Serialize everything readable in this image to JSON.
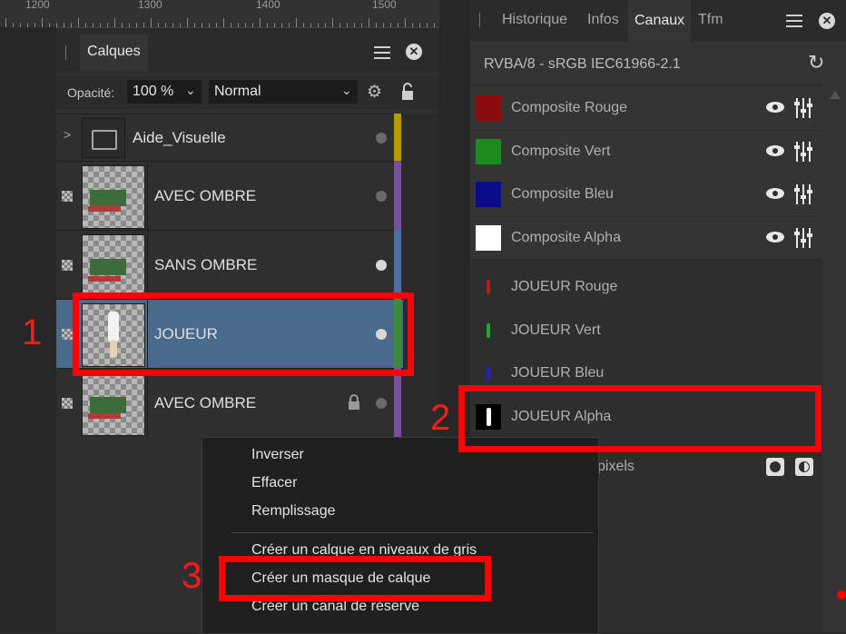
{
  "ruler": {
    "marks": [
      "1200",
      "1300",
      "1400",
      "1500"
    ]
  },
  "layers_panel": {
    "tab": "Calques",
    "opacity_label": "Opacité:",
    "opacity_value": "100 %",
    "blend_mode": "Normal",
    "layers": [
      {
        "name": "Aide_Visuelle",
        "type": "group",
        "color": "#b8960c"
      },
      {
        "name": "AVEC OMBRE",
        "type": "pixel",
        "color": "#7a4fa0"
      },
      {
        "name": "SANS OMBRE",
        "type": "pixel",
        "color": "#4a6fa0"
      },
      {
        "name": "JOUEUR",
        "type": "pixel",
        "selected": true,
        "color": "#3a8c3a"
      },
      {
        "name": "AVEC OMBRE",
        "type": "pixel",
        "locked": true,
        "color": "#7a4fa0"
      }
    ]
  },
  "channels_panel": {
    "tabs": [
      "Historique",
      "Infos",
      "Canaux",
      "Tfm"
    ],
    "active_tab": "Canaux",
    "color_profile": "RVBA/8 - sRGB IEC61966-2.1",
    "composite": [
      {
        "label": "Composite Rouge",
        "color": "#8a0c0c"
      },
      {
        "label": "Composite Vert",
        "color": "#1c8a1c"
      },
      {
        "label": "Composite Bleu",
        "color": "#0c0c8a"
      },
      {
        "label": "Composite Alpha",
        "color": "#ffffff"
      }
    ],
    "layer_channels": [
      {
        "label": "JOUEUR Rouge",
        "color": "#c01818"
      },
      {
        "label": "JOUEUR Vert",
        "color": "#18b018"
      },
      {
        "label": "JOUEUR Bleu",
        "color": "#2020d0"
      },
      {
        "label": "JOUEUR Alpha",
        "color": "#ffffff"
      }
    ],
    "partial_label": "pixels"
  },
  "context_menu": {
    "items_top": [
      "Inverser",
      "Effacer",
      "Remplissage"
    ],
    "items_bottom": [
      "Créer un calque en niveaux de gris",
      "Créer un masque de calque",
      "Créer un canal de réserve"
    ]
  },
  "annotations": [
    "1",
    "2",
    "3"
  ]
}
